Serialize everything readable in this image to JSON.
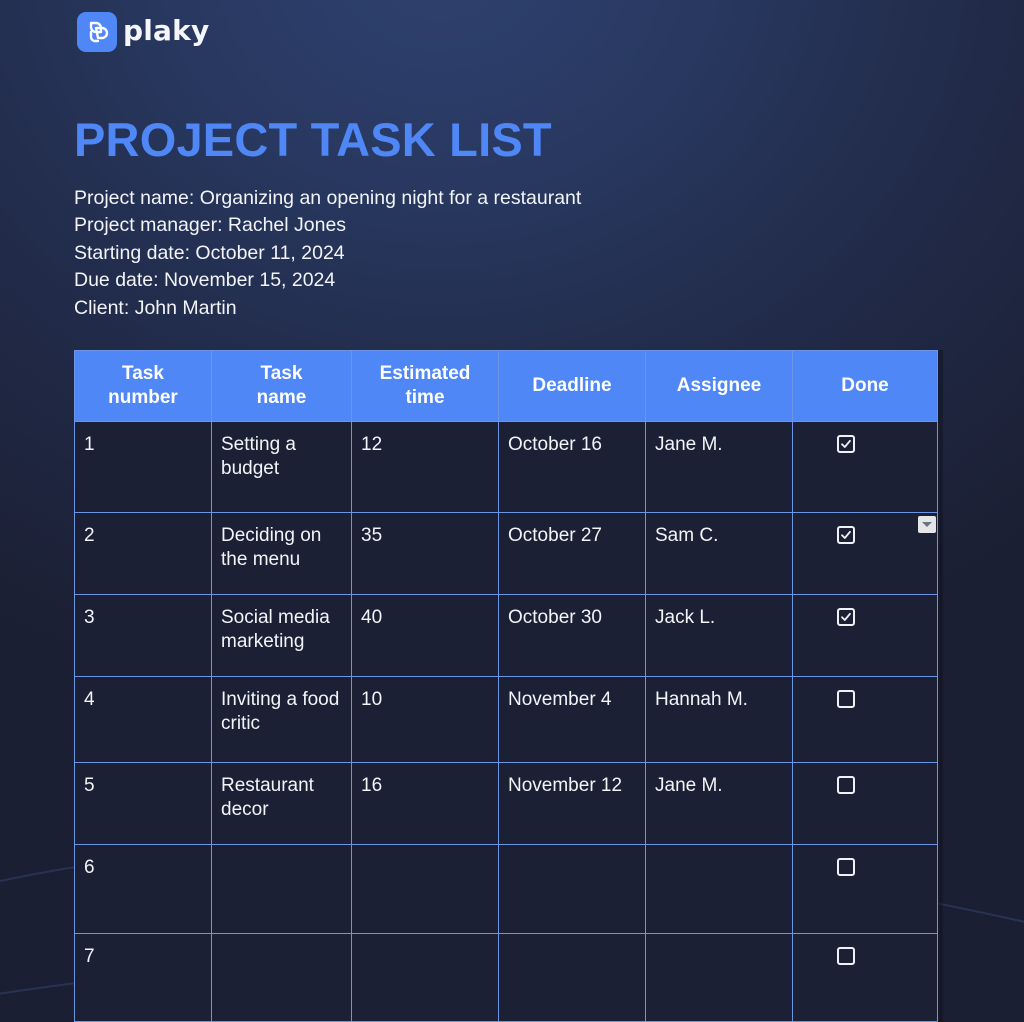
{
  "brand": {
    "name": "plaky",
    "icon": "plaky-logo-icon",
    "color": "#4f87f7"
  },
  "title": "PROJECT TASK LIST",
  "meta": [
    "Project name: Organizing an opening night for a restaurant",
    "Project manager: Rachel Jones",
    "Starting date: October 11, 2024",
    "Due date: November 15, 2024",
    "Client: John Martin"
  ],
  "table": {
    "headers": {
      "task_number": [
        "Task",
        "number"
      ],
      "task_name": [
        "Task",
        "name"
      ],
      "estimated_time": [
        "Estimated",
        "time"
      ],
      "deadline": "Deadline",
      "assignee": "Assignee",
      "done": "Done"
    },
    "rows": [
      {
        "number": "1",
        "name": "Setting a budget",
        "time": "12",
        "deadline": "October 16",
        "assignee": "Jane M.",
        "done": true
      },
      {
        "number": "2",
        "name": "Deciding on the menu",
        "time": "35",
        "deadline": "October 27",
        "assignee": "Sam C.",
        "done": true,
        "dropdown": "dropdown-arrow-icon"
      },
      {
        "number": "3",
        "name": "Social media marketing",
        "time": "40",
        "deadline": "October 30",
        "assignee": "Jack L.",
        "done": true
      },
      {
        "number": "4",
        "name": "Inviting a food critic",
        "time": "10",
        "deadline": "November 4",
        "assignee": "Hannah M.",
        "done": false
      },
      {
        "number": "5",
        "name": "Restaurant decor",
        "time": "16",
        "deadline": "November 12",
        "assignee": "Jane M.",
        "done": false
      },
      {
        "number": "6",
        "name": "",
        "time": "",
        "deadline": "",
        "assignee": "",
        "done": false
      },
      {
        "number": "7",
        "name": "",
        "time": "",
        "deadline": "",
        "assignee": "",
        "done": false
      }
    ]
  },
  "colors": {
    "accent": "#4f87f7",
    "grid": "#6d95e6",
    "cell_bg": "#1c2035",
    "text": "#f2f4f8"
  }
}
